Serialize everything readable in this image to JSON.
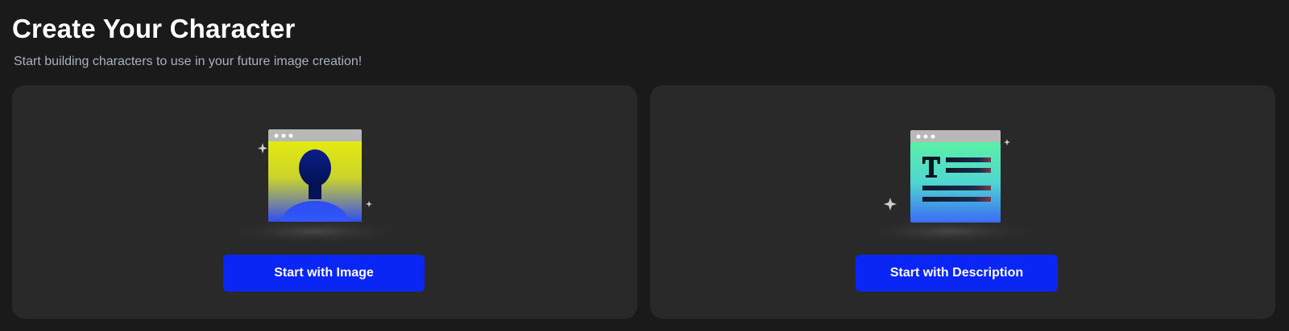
{
  "header": {
    "title": "Create Your Character",
    "subtitle": "Start building characters to use in your future image creation!"
  },
  "cards": [
    {
      "illustration": "person-silhouette-window",
      "button_label": "Start with Image"
    },
    {
      "illustration": "text-document-window",
      "button_label": "Start with Description"
    }
  ],
  "colors": {
    "background": "#1a1a1a",
    "card": "#292929",
    "accent": "#0a26f5",
    "subtitle": "#a9b1c1"
  }
}
